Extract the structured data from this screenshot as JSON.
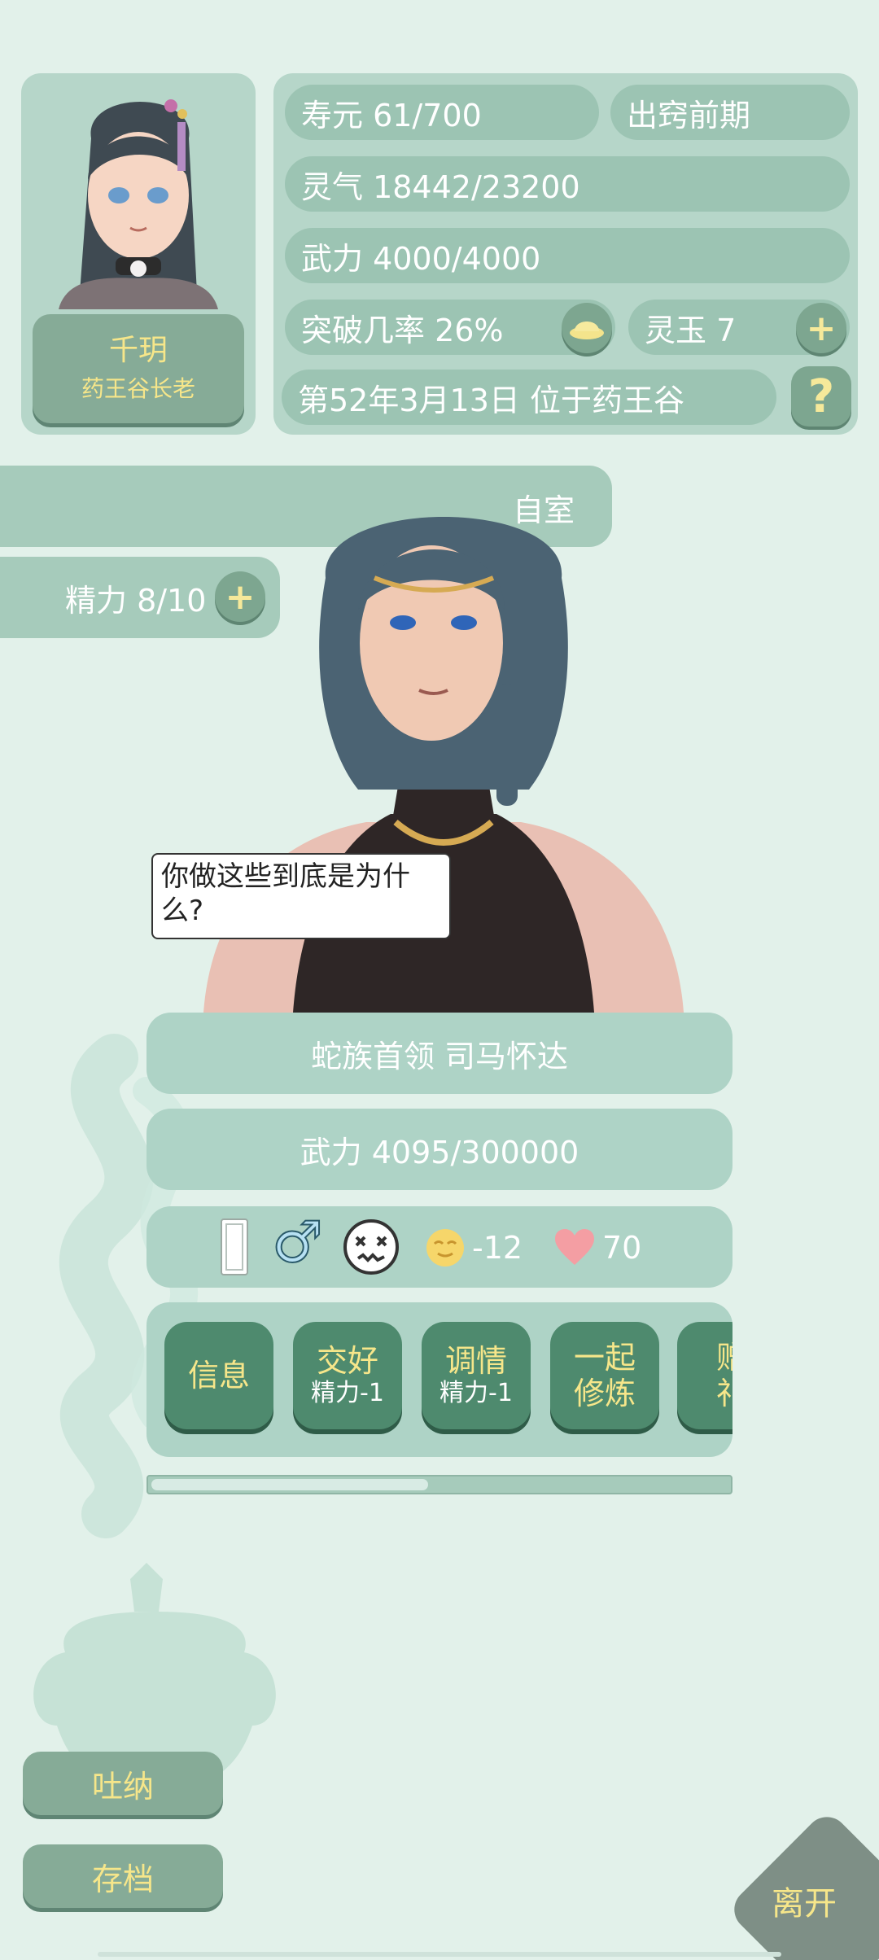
{
  "player": {
    "name": "千玥",
    "title": "药王谷长老",
    "lifespan": "寿元 61/700",
    "realm": "出窍前期",
    "spirit": "灵气 18442/23200",
    "force": "武力 4000/4000",
    "breakthrough": "突破几率 26%",
    "jade": "灵玉 7",
    "date_location": "第52年3月13日 位于药王谷"
  },
  "location_label": "自室",
  "energy": "精力 8/10",
  "npc": {
    "dialogue": "你做这些到底是为什么?",
    "name": "蛇族首领 司马怀达",
    "force": "武力 4095/300000",
    "mood": "-12",
    "affection": "70"
  },
  "actions": [
    {
      "label": "信息",
      "sub": ""
    },
    {
      "label": "交好",
      "sub": "精力-1"
    },
    {
      "label": "调情",
      "sub": "精力-1"
    },
    {
      "label": "一起",
      "sub": "修炼"
    },
    {
      "label": "赠",
      "sub": "礼"
    }
  ],
  "action_scroll_fraction": 0.48,
  "side_buttons": {
    "breathe": "吐纳",
    "save": "存档"
  },
  "leave": "离开",
  "icons": {
    "plus": "+",
    "help": "?",
    "male": "♂"
  },
  "colors": {
    "background": "#e2f1ea",
    "panel": "#b6d6c9",
    "pill": "#9cc4b3",
    "action_button": "#4e8a6e",
    "accent_text": "#f6e68a"
  }
}
